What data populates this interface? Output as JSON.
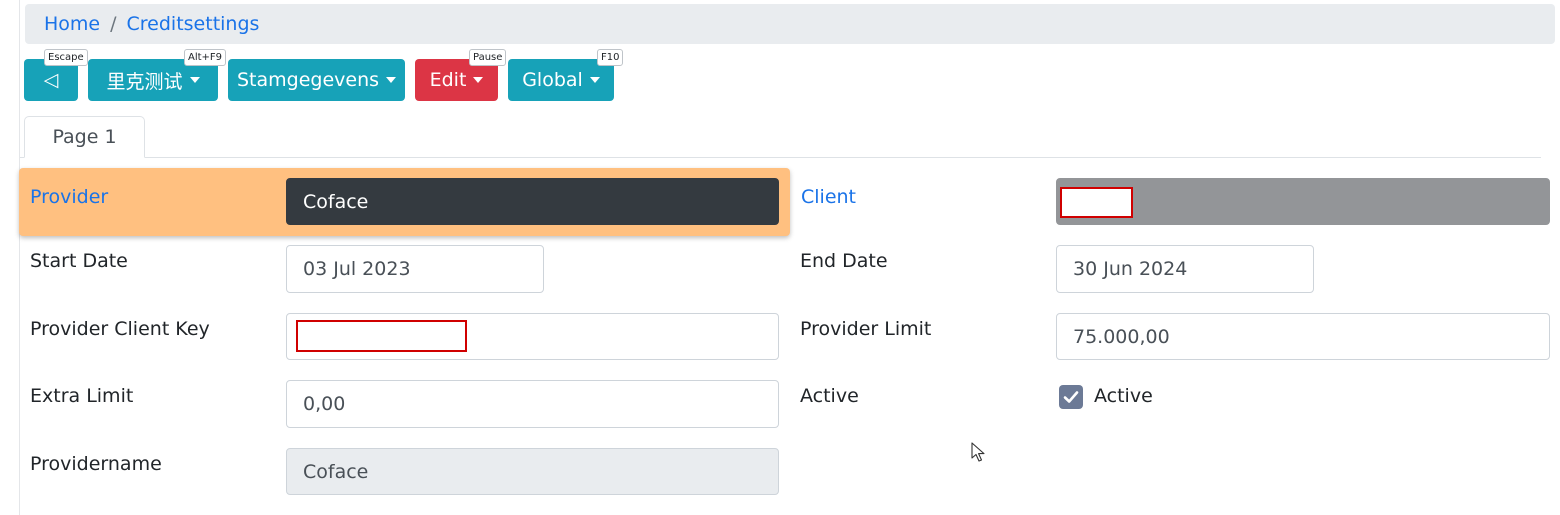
{
  "breadcrumb": {
    "items": [
      "Home",
      "Creditsettings"
    ],
    "separator": "/"
  },
  "toolbar": {
    "back": {
      "label": "◁",
      "shortcut": "Escape"
    },
    "chinese": {
      "label": "里克测试",
      "shortcut": "Alt+F9"
    },
    "stamgegevens": {
      "label": "Stamgegevens"
    },
    "edit": {
      "label": "Edit",
      "shortcut": "Pause"
    },
    "global": {
      "label": "Global",
      "shortcut": "F10"
    }
  },
  "tabs": [
    {
      "label": "Page 1",
      "active": true
    }
  ],
  "form": {
    "provider": {
      "label": "Provider",
      "value": "Coface"
    },
    "client": {
      "label": "Client",
      "value": ""
    },
    "start_date": {
      "label": "Start Date",
      "value": "03 Jul 2023"
    },
    "end_date": {
      "label": "End Date",
      "value": "30 Jun 2024"
    },
    "provider_client_key": {
      "label": "Provider Client Key",
      "value": ""
    },
    "provider_limit": {
      "label": "Provider Limit",
      "value": "75.000,00"
    },
    "extra_limit": {
      "label": "Extra Limit",
      "value": "0,00"
    },
    "active": {
      "label": "Active",
      "checkbox_label": "Active",
      "checked": true
    },
    "providername": {
      "label": "Providername",
      "value": "Coface"
    }
  },
  "colors": {
    "teal_button": "#17a2b8",
    "edit_button": "#dc3545",
    "provider_highlight": "#ffc080",
    "link": "#1a73e8",
    "redacted_border": "#d00000"
  }
}
